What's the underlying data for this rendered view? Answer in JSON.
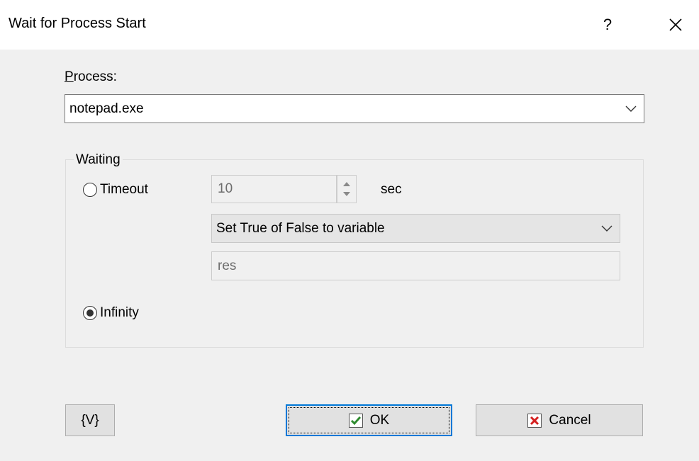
{
  "window": {
    "title": "Wait for Process Start",
    "help_label": "?"
  },
  "process": {
    "label_first": "P",
    "label_rest": "rocess:",
    "value": "notepad.exe"
  },
  "waiting": {
    "group_title": "Waiting",
    "timeout_label": "Timeout",
    "timeout_selected": false,
    "timeout_value": "10",
    "timeout_unit": "sec",
    "action_value": "Set True of False to variable",
    "variable_value": "res",
    "infinity_label": "Infinity",
    "infinity_selected": true
  },
  "buttons": {
    "variables_label": "{V}",
    "ok_label": "OK",
    "cancel_label": "Cancel"
  },
  "colors": {
    "ok_check": "#2e8b2e",
    "cancel_x": "#d42020",
    "focus_blue": "#0078d7"
  }
}
